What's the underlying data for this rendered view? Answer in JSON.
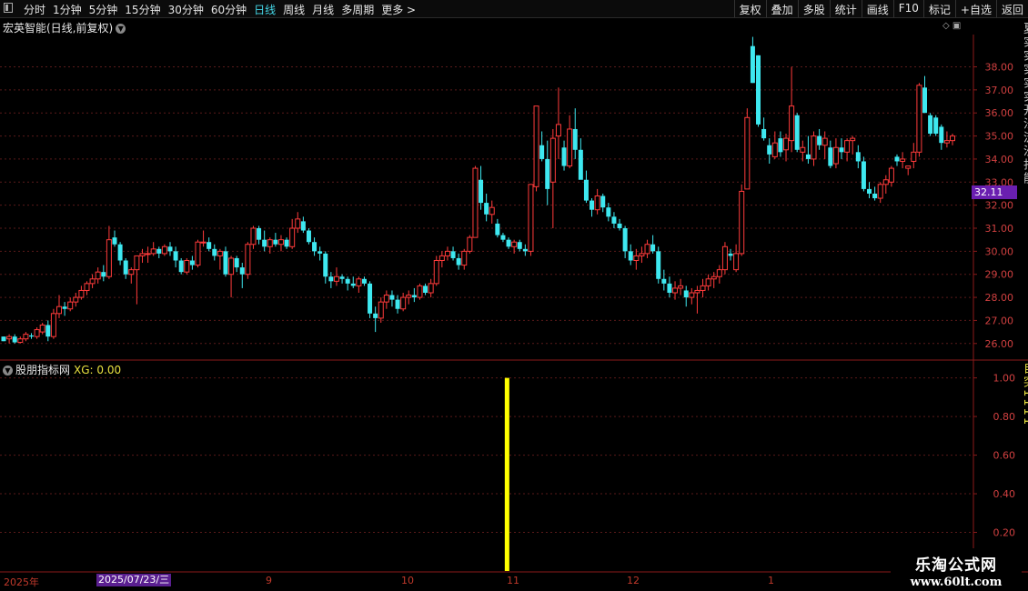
{
  "toolbar": {
    "periods": [
      "分时",
      "1分钟",
      "5分钟",
      "15分钟",
      "30分钟",
      "60分钟",
      "日线",
      "周线",
      "月线",
      "多周期",
      "更多 >"
    ],
    "active_period": "日线",
    "right_tools": [
      "复权",
      "叠加",
      "多股",
      "统计",
      "画线",
      "F10",
      "标记",
      "+自选",
      "返回"
    ]
  },
  "stock_title": "宏英智能(日线,前复权)",
  "indicator_title": "股朋指标网",
  "indicator_value": "XG: 0.00",
  "current_price": "32.11",
  "cursor_date": "2025/07/23/三",
  "year_label": "2025年",
  "months": [
    "9",
    "10",
    "11",
    "12",
    "1"
  ],
  "right_edge_text": "夏实实实实实开法流沙打能",
  "right_edge_text2": "自突1111",
  "watermark": {
    "line1": "乐淘公式网",
    "line2": "www.60lt.com"
  },
  "colors": {
    "up": "#ff3b3b",
    "down": "#3ee8f0",
    "grid": "#5a1a1a",
    "axis": "#8b1a1a",
    "signal": "#ffff00",
    "badge": "#6a1fb0"
  },
  "chart_data": [
    {
      "type": "candlestick",
      "title": "宏英智能(日线,前复权)",
      "ylim": [
        25.4,
        39.4
      ],
      "yticks": [
        26.0,
        27.0,
        28.0,
        29.0,
        30.0,
        31.0,
        32.0,
        33.0,
        34.0,
        35.0,
        36.0,
        37.0,
        38.0
      ],
      "candles": [
        [
          26.3,
          26.3,
          26.1,
          26.1
        ],
        [
          26.2,
          26.4,
          26.0,
          26.3
        ],
        [
          26.3,
          26.4,
          26.0,
          26.05
        ],
        [
          26.05,
          26.3,
          26.0,
          26.2
        ],
        [
          26.2,
          26.5,
          26.1,
          26.4
        ],
        [
          26.35,
          26.45,
          26.2,
          26.3
        ],
        [
          26.3,
          26.7,
          26.2,
          26.6
        ],
        [
          26.5,
          26.9,
          26.4,
          26.8
        ],
        [
          26.8,
          27.0,
          26.1,
          26.3
        ],
        [
          26.3,
          27.5,
          26.2,
          27.3
        ],
        [
          27.3,
          28.1,
          27.1,
          27.6
        ],
        [
          27.6,
          27.8,
          27.2,
          27.5
        ],
        [
          27.5,
          28.0,
          27.4,
          27.8
        ],
        [
          27.8,
          28.2,
          27.6,
          28.0
        ],
        [
          28.0,
          28.5,
          27.9,
          28.3
        ],
        [
          28.3,
          28.7,
          28.1,
          28.6
        ],
        [
          28.6,
          29.0,
          28.4,
          28.8
        ],
        [
          28.8,
          29.3,
          28.6,
          29.1
        ],
        [
          29.1,
          29.4,
          28.7,
          28.9
        ],
        [
          28.9,
          31.1,
          28.8,
          30.5
        ],
        [
          30.6,
          30.9,
          30.2,
          30.3
        ],
        [
          30.3,
          30.4,
          29.4,
          29.6
        ],
        [
          29.6,
          29.7,
          28.8,
          29.0
        ],
        [
          29.0,
          29.3,
          28.6,
          29.2
        ],
        [
          29.2,
          29.8,
          27.7,
          29.8
        ],
        [
          29.8,
          30.1,
          29.5,
          29.9
        ],
        [
          29.9,
          30.2,
          29.5,
          29.9
        ],
        [
          29.9,
          30.4,
          29.8,
          30.1
        ],
        [
          30.1,
          30.2,
          29.7,
          29.9
        ],
        [
          29.9,
          30.3,
          29.8,
          30.2
        ],
        [
          30.2,
          30.4,
          29.8,
          30.0
        ],
        [
          30.0,
          30.2,
          29.3,
          29.6
        ],
        [
          29.6,
          29.7,
          29.0,
          29.1
        ],
        [
          29.1,
          29.7,
          29.0,
          29.6
        ],
        [
          29.6,
          29.8,
          29.2,
          29.4
        ],
        [
          29.4,
          30.5,
          29.3,
          30.4
        ],
        [
          30.4,
          30.9,
          30.2,
          30.4
        ],
        [
          30.4,
          30.6,
          30.0,
          30.1
        ],
        [
          30.1,
          30.3,
          29.6,
          29.8
        ],
        [
          29.8,
          30.1,
          29.2,
          30.0
        ],
        [
          30.0,
          30.2,
          28.9,
          29.0
        ],
        [
          29.0,
          29.8,
          28.0,
          29.7
        ],
        [
          29.7,
          29.8,
          29.1,
          29.3
        ],
        [
          29.3,
          29.5,
          28.4,
          29.0
        ],
        [
          29.0,
          30.4,
          28.8,
          30.3
        ],
        [
          30.3,
          31.1,
          30.1,
          31.0
        ],
        [
          31.0,
          31.1,
          30.3,
          30.5
        ],
        [
          30.5,
          30.9,
          30.0,
          30.2
        ],
        [
          30.2,
          30.6,
          29.9,
          30.5
        ],
        [
          30.5,
          30.8,
          30.2,
          30.3
        ],
        [
          30.3,
          30.7,
          30.0,
          30.5
        ],
        [
          30.5,
          30.6,
          30.1,
          30.2
        ],
        [
          30.2,
          31.4,
          30.1,
          31.0
        ],
        [
          31.0,
          31.7,
          30.8,
          31.4
        ],
        [
          31.3,
          31.5,
          30.8,
          30.9
        ],
        [
          30.9,
          31.0,
          30.3,
          30.4
        ],
        [
          30.4,
          30.6,
          29.8,
          30.0
        ],
        [
          30.0,
          30.2,
          29.6,
          29.9
        ],
        [
          29.9,
          30.0,
          28.6,
          28.9
        ],
        [
          28.9,
          29.1,
          28.4,
          28.7
        ],
        [
          28.7,
          29.3,
          28.5,
          28.9
        ],
        [
          28.9,
          29.0,
          28.6,
          28.8
        ],
        [
          28.8,
          28.9,
          28.3,
          28.6
        ],
        [
          28.6,
          28.9,
          28.4,
          28.5
        ],
        [
          28.5,
          28.9,
          28.2,
          28.8
        ],
        [
          28.8,
          28.9,
          28.5,
          28.6
        ],
        [
          28.6,
          28.7,
          27.1,
          27.3
        ],
        [
          27.3,
          27.6,
          26.5,
          27.1
        ],
        [
          27.1,
          28.0,
          26.9,
          27.8
        ],
        [
          27.8,
          28.3,
          27.5,
          28.1
        ],
        [
          28.1,
          28.3,
          27.6,
          27.9
        ],
        [
          27.9,
          28.1,
          27.3,
          27.5
        ],
        [
          27.5,
          28.2,
          27.4,
          28.0
        ],
        [
          28.0,
          28.3,
          27.7,
          28.1
        ],
        [
          28.1,
          28.4,
          27.8,
          28.0
        ],
        [
          28.0,
          28.6,
          27.9,
          28.5
        ],
        [
          28.5,
          28.6,
          28.1,
          28.2
        ],
        [
          28.2,
          28.8,
          28.0,
          28.6
        ],
        [
          28.6,
          29.8,
          28.5,
          29.6
        ],
        [
          29.6,
          30.0,
          29.3,
          29.8
        ],
        [
          29.8,
          30.2,
          29.6,
          30.0
        ],
        [
          30.0,
          30.2,
          29.6,
          29.7
        ],
        [
          29.7,
          29.9,
          29.2,
          29.4
        ],
        [
          29.4,
          30.1,
          29.2,
          30.0
        ],
        [
          30.0,
          30.7,
          29.9,
          30.6
        ],
        [
          30.6,
          33.7,
          30.6,
          33.6
        ],
        [
          33.1,
          33.7,
          31.8,
          32.1
        ],
        [
          32.1,
          32.5,
          31.3,
          31.6
        ],
        [
          31.6,
          32.2,
          31.2,
          31.9
        ],
        [
          31.2,
          31.4,
          30.6,
          30.7
        ],
        [
          30.7,
          30.8,
          30.4,
          30.5
        ],
        [
          30.5,
          30.6,
          30.1,
          30.2
        ],
        [
          30.2,
          30.5,
          29.9,
          30.4
        ],
        [
          30.4,
          30.5,
          30.0,
          30.1
        ],
        [
          30.1,
          30.3,
          29.8,
          30.0
        ],
        [
          30.0,
          32.9,
          29.8,
          32.9
        ],
        [
          32.8,
          36.3,
          32.6,
          36.3
        ],
        [
          34.6,
          35.2,
          33.9,
          34.0
        ],
        [
          34.0,
          34.8,
          32.0,
          32.7
        ],
        [
          33.0,
          35.3,
          31.0,
          34.9
        ],
        [
          35.0,
          37.1,
          34.0,
          35.5
        ],
        [
          34.5,
          34.8,
          33.5,
          33.7
        ],
        [
          33.7,
          35.9,
          33.6,
          35.3
        ],
        [
          35.3,
          36.2,
          34.0,
          34.4
        ],
        [
          34.4,
          34.9,
          33.4,
          33.1
        ],
        [
          33.1,
          33.5,
          32.1,
          32.2
        ],
        [
          32.2,
          32.3,
          31.5,
          31.8
        ],
        [
          31.8,
          32.7,
          31.6,
          32.4
        ],
        [
          32.4,
          32.5,
          31.7,
          31.9
        ],
        [
          31.9,
          32.1,
          31.3,
          31.5
        ],
        [
          31.5,
          31.7,
          31.0,
          31.2
        ],
        [
          31.2,
          31.4,
          30.9,
          31.0
        ],
        [
          31.0,
          31.1,
          29.7,
          30.0
        ],
        [
          30.0,
          30.3,
          29.4,
          29.6
        ],
        [
          29.6,
          30.1,
          29.2,
          29.8
        ],
        [
          29.8,
          30.2,
          29.5,
          29.9
        ],
        [
          29.9,
          30.5,
          29.7,
          30.3
        ],
        [
          30.3,
          30.7,
          29.9,
          30.0
        ],
        [
          30.0,
          30.2,
          28.6,
          28.8
        ],
        [
          28.8,
          29.2,
          28.3,
          28.6
        ],
        [
          28.6,
          28.9,
          28.0,
          28.2
        ],
        [
          28.2,
          28.7,
          27.9,
          28.4
        ],
        [
          28.4,
          28.8,
          28.1,
          28.5
        ],
        [
          28.3,
          28.5,
          27.6,
          28.0
        ],
        [
          28.0,
          28.4,
          27.7,
          28.2
        ],
        [
          28.2,
          28.5,
          27.3,
          28.3
        ],
        [
          28.3,
          28.8,
          28.0,
          28.5
        ],
        [
          28.5,
          29.0,
          28.3,
          28.8
        ],
        [
          28.8,
          29.1,
          28.4,
          28.9
        ],
        [
          28.9,
          29.4,
          28.6,
          29.2
        ],
        [
          29.2,
          30.4,
          29.0,
          30.2
        ],
        [
          29.9,
          30.1,
          29.6,
          29.8
        ],
        [
          29.2,
          30.3,
          29.1,
          29.9
        ],
        [
          29.9,
          32.9,
          29.8,
          32.6
        ],
        [
          32.7,
          36.2,
          33.0,
          35.8
        ],
        [
          38.9,
          39.3,
          37.3,
          37.3
        ],
        [
          38.5,
          38.5,
          35.4,
          35.5
        ],
        [
          35.3,
          35.8,
          34.8,
          34.9
        ],
        [
          34.6,
          34.9,
          33.8,
          34.2
        ],
        [
          34.1,
          35.2,
          34.0,
          34.7
        ],
        [
          34.9,
          35.2,
          34.1,
          34.3
        ],
        [
          34.4,
          35.1,
          33.9,
          34.9
        ],
        [
          34.8,
          38.0,
          34.3,
          36.3
        ],
        [
          35.9,
          36.0,
          34.3,
          34.4
        ],
        [
          34.3,
          34.8,
          33.9,
          34.5
        ],
        [
          34.2,
          35.0,
          33.8,
          34.0
        ],
        [
          34.0,
          35.2,
          33.7,
          35.0
        ],
        [
          35.0,
          35.3,
          34.4,
          34.6
        ],
        [
          34.6,
          35.2,
          34.0,
          34.9
        ],
        [
          34.5,
          34.8,
          33.6,
          33.7
        ],
        [
          33.8,
          34.9,
          33.6,
          34.5
        ],
        [
          34.5,
          34.9,
          34.0,
          34.3
        ],
        [
          34.3,
          34.9,
          33.9,
          34.8
        ],
        [
          34.8,
          35.0,
          34.2,
          34.9
        ],
        [
          34.3,
          34.6,
          33.6,
          33.9
        ],
        [
          33.9,
          34.1,
          32.6,
          32.7
        ],
        [
          32.7,
          33.0,
          32.3,
          32.5
        ],
        [
          32.5,
          32.8,
          32.2,
          32.3
        ],
        [
          32.3,
          33.0,
          32.1,
          32.9
        ],
        [
          32.9,
          33.3,
          32.5,
          33.1
        ],
        [
          33.0,
          33.7,
          32.8,
          33.6
        ],
        [
          34.1,
          34.2,
          33.7,
          33.9
        ],
        [
          33.9,
          34.3,
          33.6,
          34.0
        ],
        [
          33.6,
          33.7,
          33.3,
          33.7
        ],
        [
          33.9,
          34.7,
          33.6,
          34.3
        ],
        [
          34.3,
          37.3,
          34.1,
          37.2
        ],
        [
          37.1,
          37.6,
          36.3,
          36.0
        ],
        [
          35.9,
          36.0,
          35.0,
          35.1
        ],
        [
          35.8,
          35.9,
          35.0,
          35.1
        ],
        [
          35.4,
          35.5,
          34.4,
          34.7
        ],
        [
          34.7,
          35.2,
          34.5,
          34.8
        ],
        [
          34.8,
          35.1,
          34.6,
          35.0
        ]
      ]
    },
    {
      "type": "bar",
      "title": "股朋指标网",
      "series": [
        {
          "name": "XG",
          "values": [
            {
              "x": "2025-11-14",
              "y": 1.0
            }
          ]
        }
      ],
      "ylim": [
        0,
        1.05
      ],
      "yticks": [
        0.2,
        0.4,
        0.6,
        0.8,
        1.0
      ]
    }
  ]
}
